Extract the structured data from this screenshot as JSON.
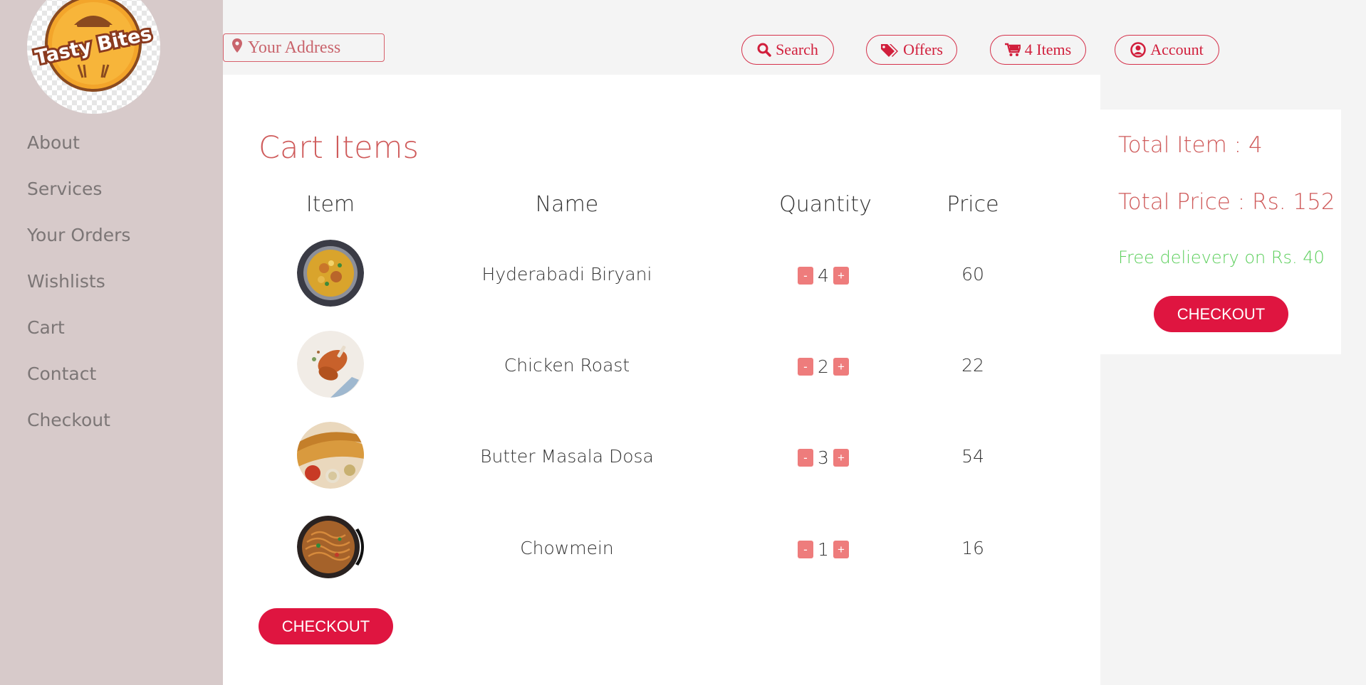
{
  "logo": {
    "text": "Tasty Bites"
  },
  "sidebar": {
    "items": [
      {
        "label": "About"
      },
      {
        "label": "Services"
      },
      {
        "label": "Your Orders"
      },
      {
        "label": "Wishlists"
      },
      {
        "label": "Cart"
      },
      {
        "label": "Contact"
      },
      {
        "label": "Checkout"
      }
    ]
  },
  "topbar": {
    "address_placeholder": "Your Address",
    "search_label": "Search",
    "offers_label": "Offers",
    "cart_label": "4 Items",
    "account_label": "Account"
  },
  "cart": {
    "title": "Cart Items",
    "headers": {
      "item": "Item",
      "name": "Name",
      "quantity": "Quantity",
      "price": "Price"
    },
    "rows": [
      {
        "name": "Hyderabadi Biryani",
        "quantity": "4",
        "price": "60",
        "image": "biryani"
      },
      {
        "name": "Chicken Roast",
        "quantity": "2",
        "price": "22",
        "image": "chicken-roast"
      },
      {
        "name": "Butter Masala Dosa",
        "quantity": "3",
        "price": "54",
        "image": "dosa"
      },
      {
        "name": "Chowmein",
        "quantity": "1",
        "price": "16",
        "image": "chowmein"
      }
    ],
    "minus_label": "-",
    "plus_label": "+",
    "checkout_label": "CHECKOUT"
  },
  "summary": {
    "total_items": "Total Item : 4",
    "total_price": "Total Price : Rs. 152",
    "delivery_note": "Free delievery on Rs. 40",
    "checkout_label": "CHECKOUT"
  },
  "colors": {
    "accent": "#df1540",
    "title": "#cf5b5b",
    "sidebar_bg": "#d7caca",
    "delivery_green": "#5ccf5c",
    "qty_button": "#ee7c7c"
  }
}
